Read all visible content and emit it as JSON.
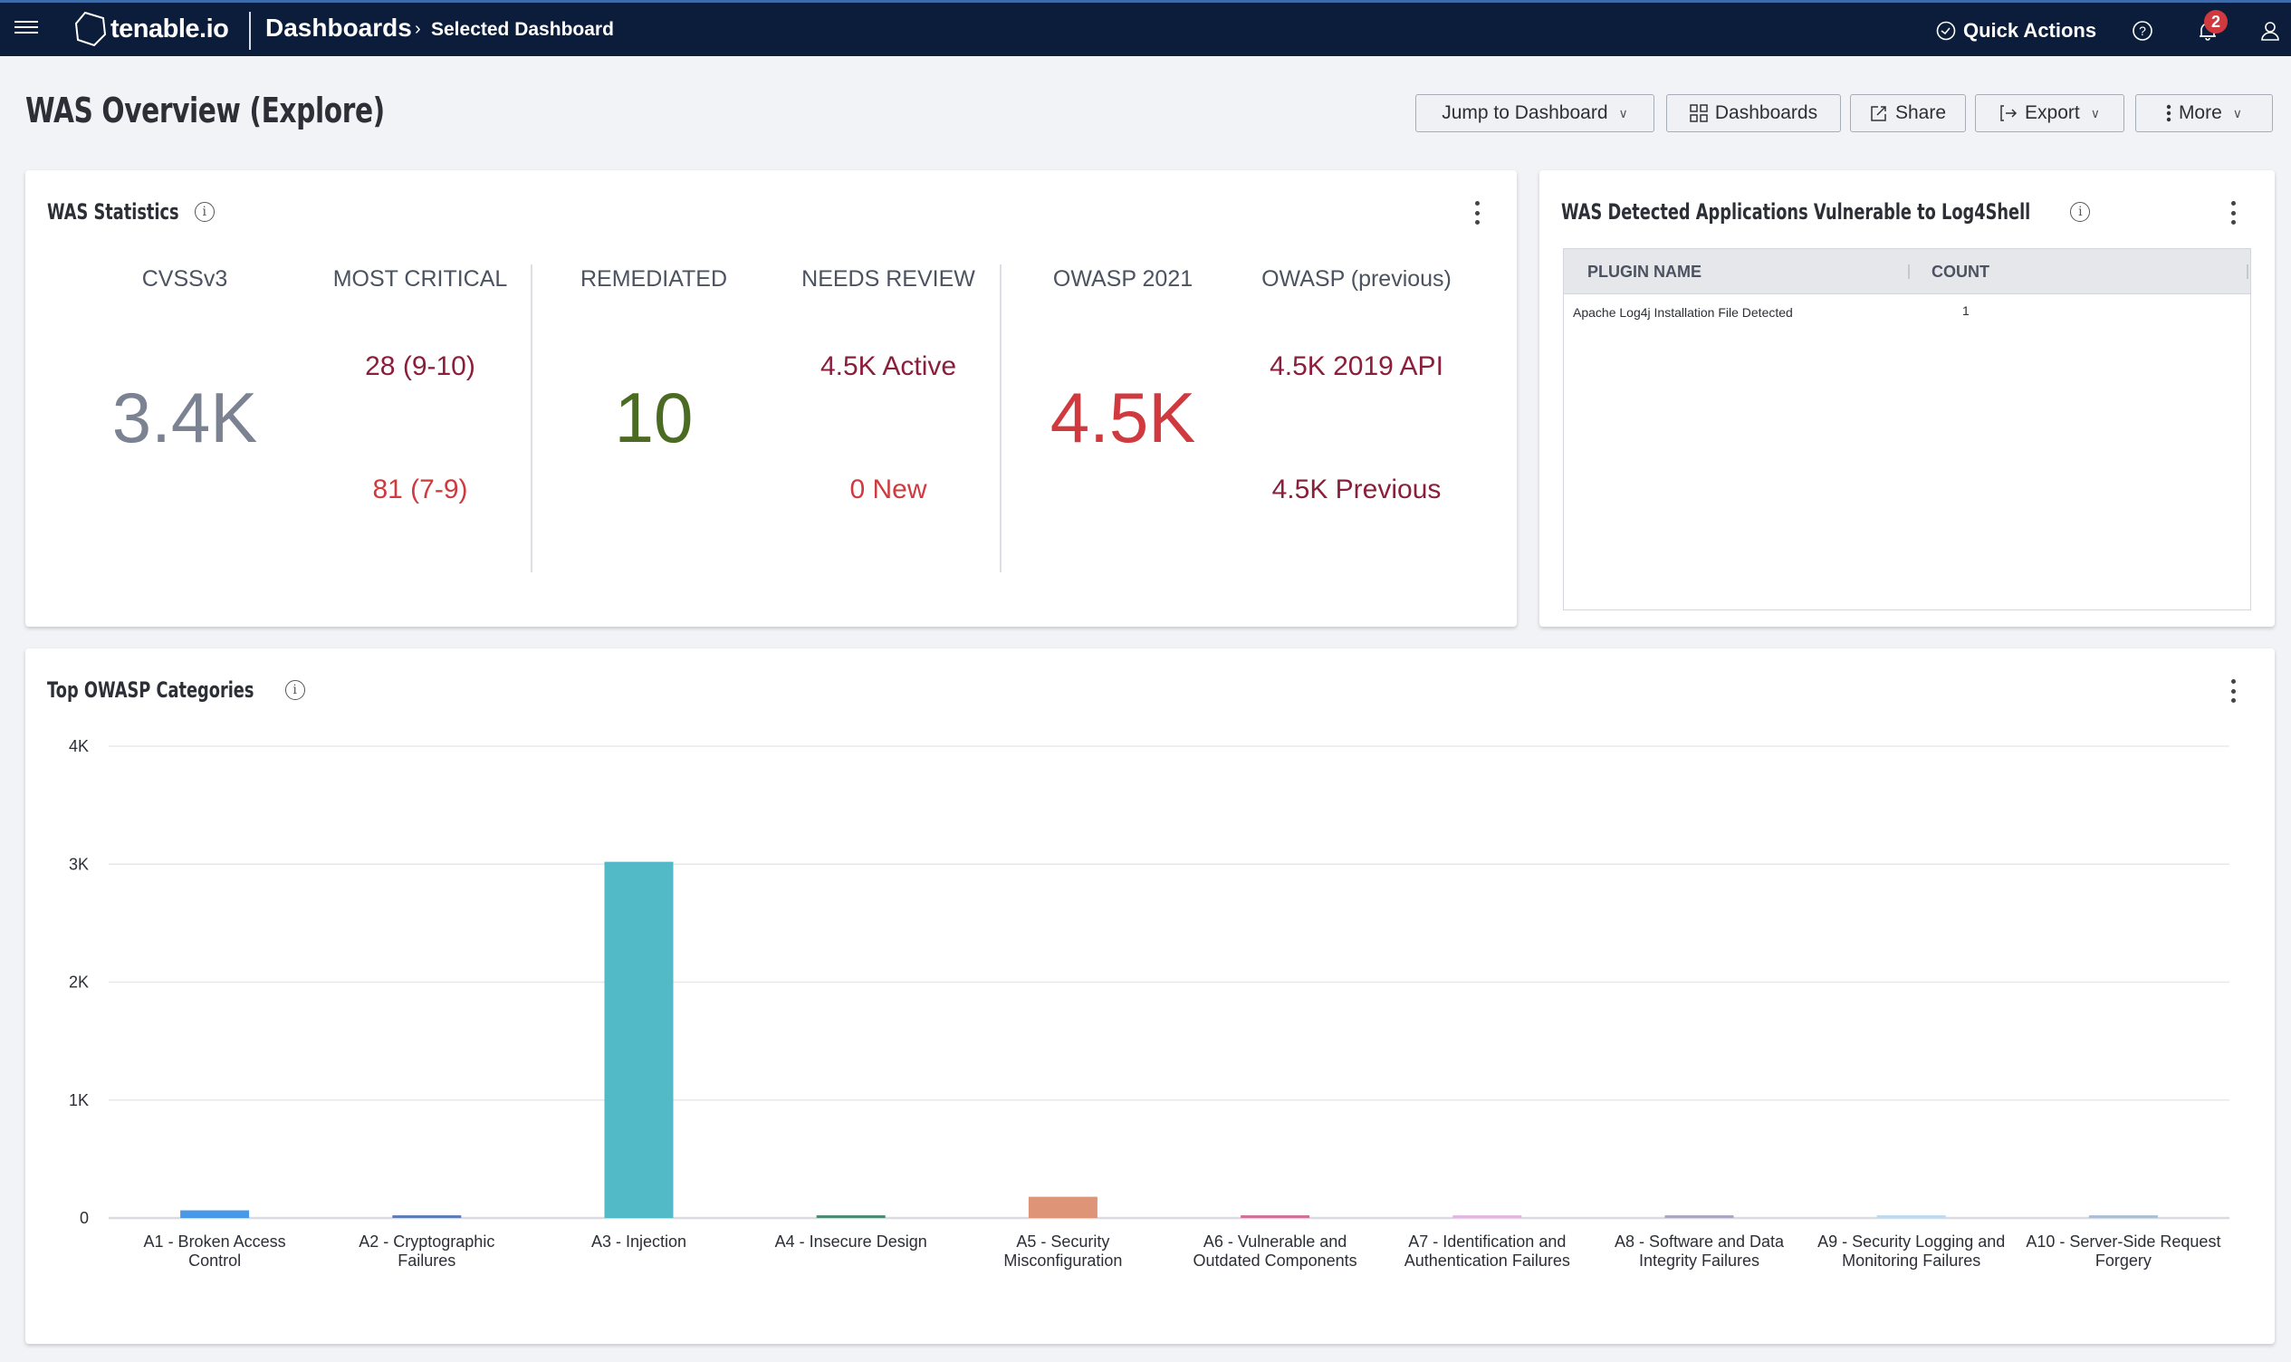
{
  "navbar": {
    "brand": "tenable.io",
    "crumb": "Dashboards",
    "crumb_sep": "›",
    "crumb_sub": "Selected Dashboard",
    "quick_actions": "Quick Actions",
    "notification_count": "2",
    "icons": [
      "menu-icon",
      "tenable-logo-icon",
      "clock-icon",
      "help-icon",
      "bell-icon",
      "user-icon"
    ]
  },
  "page": {
    "title": "WAS Overview (Explore)"
  },
  "toolbar": {
    "jump": "Jump to Dashboard",
    "dashboards": "Dashboards",
    "share": "Share",
    "export": "Export",
    "more": "More"
  },
  "stats_panel": {
    "title": "WAS Statistics",
    "groups": [
      {
        "left": {
          "head": "CVSSv3",
          "big": "3.4K",
          "color": "#7b8291"
        },
        "right": {
          "head": "MOST CRITICAL",
          "top": "28 (9-10)",
          "bottom": "81 (7-9)",
          "top_color": "#8b1e3a",
          "bottom_color": "#d0393e"
        }
      },
      {
        "left": {
          "head": "REMEDIATED",
          "big": "10",
          "color": "#4c6b22"
        },
        "right": {
          "head": "NEEDS REVIEW",
          "top": "4.5K Active",
          "bottom": "0 New",
          "top_color": "#8b1e3a",
          "bottom_color": "#d0393e"
        }
      },
      {
        "left": {
          "head": "OWASP 2021",
          "big": "4.5K",
          "color": "#d0393e"
        },
        "right": {
          "head": "OWASP (previous)",
          "top": "4.5K 2019 API",
          "bottom": "4.5K Previous",
          "top_color": "#8b1e3a",
          "bottom_color": "#8b1e3a"
        }
      }
    ]
  },
  "log4shell_panel": {
    "title": "WAS Detected Applications Vulnerable to Log4Shell",
    "columns": [
      "PLUGIN NAME",
      "COUNT"
    ],
    "rows": [
      {
        "plugin": "Apache Log4j Installation File Detected",
        "count": "1"
      }
    ]
  },
  "owasp_panel": {
    "title": "Top OWASP Categories"
  },
  "chart_data": {
    "type": "bar",
    "title": "Top OWASP Categories",
    "xlabel": "",
    "ylabel": "",
    "ylim": [
      0,
      4000
    ],
    "yticks": [
      0,
      1000,
      2000,
      3000,
      4000
    ],
    "ytick_labels": [
      "0",
      "1K",
      "2K",
      "3K",
      "4K"
    ],
    "grid": true,
    "legend": "none",
    "categories": [
      [
        "A1 - Broken Access",
        "Control"
      ],
      [
        "A2 - Cryptographic",
        "Failures"
      ],
      [
        "A3 - Injection"
      ],
      [
        "A4 - Insecure Design"
      ],
      [
        "A5 - Security",
        "Misconfiguration"
      ],
      [
        "A6 - Vulnerable and",
        "Outdated Components"
      ],
      [
        "A7 - Identification and",
        "Authentication Failures"
      ],
      [
        "A8 - Software and Data",
        "Integrity Failures"
      ],
      [
        "A9 - Security Logging and",
        "Monitoring Failures"
      ],
      [
        "A10 - Server-Side Request",
        "Forgery"
      ]
    ],
    "values": [
      65,
      10,
      3020,
      10,
      180,
      8,
      5,
      5,
      5,
      5
    ],
    "colors": [
      "#4a98e8",
      "#5d7fb5",
      "#52b9c6",
      "#4f8a78",
      "#de9477",
      "#cf7198",
      "#e2b7e3",
      "#a9a8c2",
      "#bcdaf0",
      "#aebed6"
    ]
  }
}
